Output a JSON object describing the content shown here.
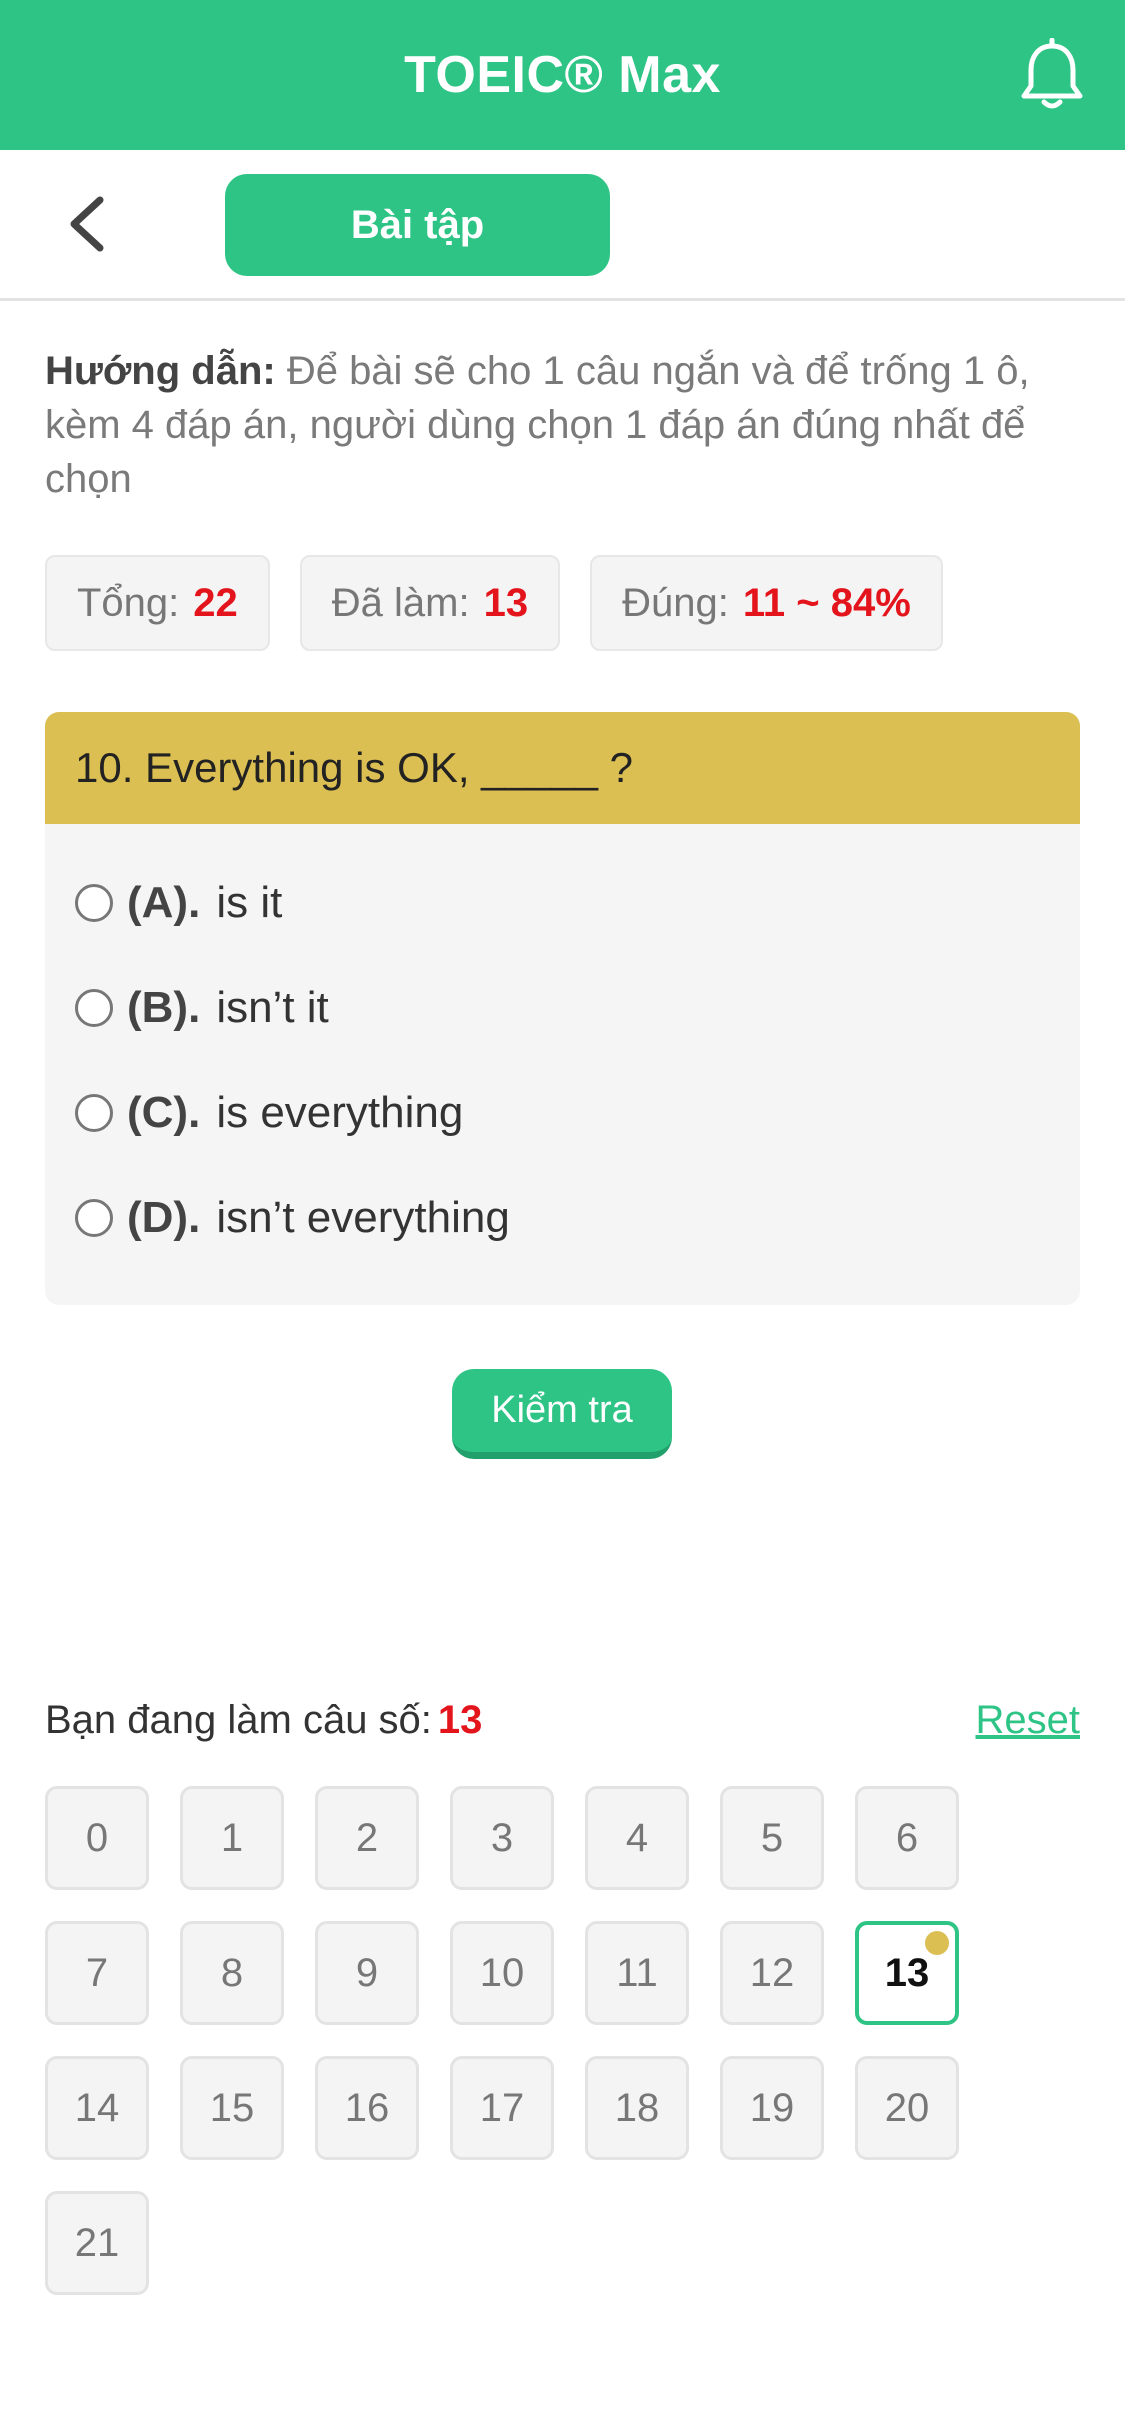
{
  "header": {
    "title": "TOEIC® Max",
    "color": "#2ec486"
  },
  "nav": {
    "tab_label": "Bài tập"
  },
  "instructions": {
    "label": "Hướng dẫn:",
    "text": " Để bài sẽ cho 1 câu ngắn và để trống 1 ô, kèm 4 đáp án, người dùng chọn 1 đáp án đúng nhất để chọn"
  },
  "stats": {
    "total_label": "Tổng:",
    "total_value": "22",
    "done_label": "Đã làm:",
    "done_value": "13",
    "correct_label": "Đúng:",
    "correct_value": "11 ~ 84%"
  },
  "question": {
    "text": "10. Everything is OK, _____ ?",
    "options": [
      {
        "letter": "(A).",
        "text": "is it"
      },
      {
        "letter": "(B).",
        "text": "isn’t it"
      },
      {
        "letter": "(C).",
        "text": "is everything"
      },
      {
        "letter": "(D).",
        "text": "isn’t everything"
      }
    ]
  },
  "check_button": "Kiểm tra",
  "progress": {
    "label": "Bạn đang làm câu số:",
    "current": "13",
    "reset_label": "Reset"
  },
  "question_numbers": [
    "0",
    "1",
    "2",
    "3",
    "4",
    "5",
    "6",
    "7",
    "8",
    "9",
    "10",
    "11",
    "12",
    "13",
    "14",
    "15",
    "16",
    "17",
    "18",
    "19",
    "20",
    "21"
  ],
  "current_index": 13,
  "colors": {
    "accent": "#2ec486",
    "question_header": "#dcbf52",
    "number_highlight": "#e3141b",
    "current_dot": "#dcbf52"
  }
}
